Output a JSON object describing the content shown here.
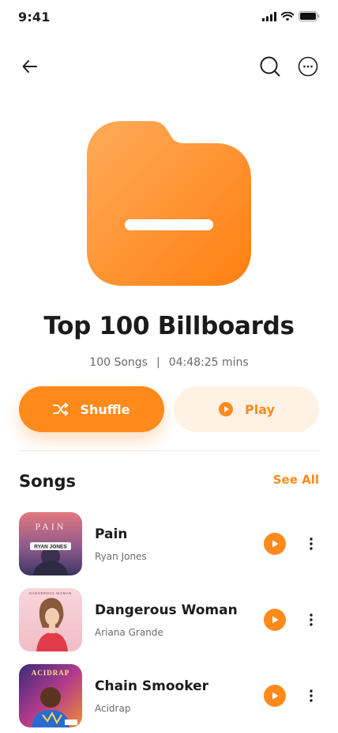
{
  "status_bar": {
    "time": "9:41",
    "icons": [
      "signal-icon",
      "wifi-icon",
      "battery-icon"
    ]
  },
  "header": {
    "back_icon": "arrow-left-icon",
    "search_icon": "search-icon",
    "more_icon": "more-circle-icon"
  },
  "playlist": {
    "title": "Top 100 Billboards",
    "song_count": "100 Songs",
    "separator": "|",
    "duration": "04:48:25 mins",
    "art_icon": "folder-icon"
  },
  "actions": {
    "shuffle_label": "Shuffle",
    "shuffle_icon": "shuffle-icon",
    "play_label": "Play",
    "play_icon": "play-circle-icon"
  },
  "songs_section": {
    "heading": "Songs",
    "see_all_label": "See All",
    "items": [
      {
        "title": "Pain",
        "artist": "Ryan Jones",
        "cover_text": "PAIN",
        "cover_subtext": "RYAN JONES"
      },
      {
        "title": "Dangerous Woman",
        "artist": "Ariana Grande",
        "cover_text": "DANGEROUS WOMAN",
        "cover_subtext": ""
      },
      {
        "title": "Chain Smooker",
        "artist": "Acidrap",
        "cover_text": "ACIDRAP",
        "cover_subtext": ""
      }
    ]
  },
  "colors": {
    "accent": "#ff8a1c",
    "accent_light": "#fff1e4",
    "text_primary": "#1b1b1b",
    "text_secondary": "#6b6b6b"
  }
}
